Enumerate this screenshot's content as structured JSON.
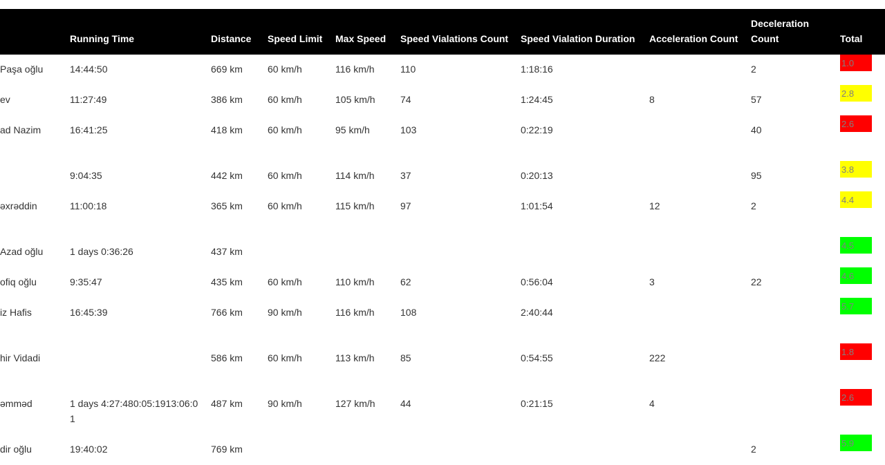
{
  "colors": {
    "red": "#ff0000",
    "yellow": "#ffff00",
    "green": "#00ff00"
  },
  "headers": {
    "name": "",
    "running_time": "Running Time",
    "distance": "Distance",
    "speed_limit": "Speed Limit",
    "max_speed": "Max Speed",
    "violations_count": "Speed Vialations Count",
    "violation_duration": "Speed Vialation Duration",
    "acceleration_count": "Acceleration Count",
    "deceleration_count": "Deceleration Count",
    "total": "Total"
  },
  "rows": [
    {
      "name": "Paşa oğlu",
      "running_time": "14:44:50",
      "distance": "669 km",
      "speed_limit": "60 km/h",
      "max_speed": "116 km/h",
      "violations_count": "110",
      "violation_duration": "1:18:16",
      "acceleration_count": "",
      "deceleration_count": "2",
      "total": "1.0",
      "total_color": "red"
    },
    {
      "name": "ev",
      "running_time": "11:27:49",
      "distance": "386 km",
      "speed_limit": "60 km/h",
      "max_speed": "105 km/h",
      "violations_count": "74",
      "violation_duration": "1:24:45",
      "acceleration_count": "8",
      "deceleration_count": "57",
      "total": "2.8",
      "total_color": "yellow"
    },
    {
      "name": "ad Nazim",
      "running_time": "16:41:25",
      "distance": "418 km",
      "speed_limit": "60 km/h",
      "max_speed": "95 km/h",
      "violations_count": "103",
      "violation_duration": "0:22:19",
      "acceleration_count": "",
      "deceleration_count": "40",
      "total": "2.6",
      "total_color": "red"
    },
    {
      "name": "",
      "running_time": "9:04:35",
      "distance": "442 km",
      "speed_limit": "60 km/h",
      "max_speed": "114 km/h",
      "violations_count": "37",
      "violation_duration": "0:20:13",
      "acceleration_count": "",
      "deceleration_count": "95",
      "total": "3.8",
      "total_color": "yellow"
    },
    {
      "name": "əxrəddin",
      "running_time": "11:00:18",
      "distance": "365 km",
      "speed_limit": "60 km/h",
      "max_speed": "115 km/h",
      "violations_count": "97",
      "violation_duration": "1:01:54",
      "acceleration_count": "12",
      "deceleration_count": "2",
      "total": "4.4",
      "total_color": "yellow"
    },
    {
      "name": "Azad oğlu",
      "running_time": "1 days 0:36:26",
      "distance": "437 km",
      "speed_limit": "",
      "max_speed": "",
      "violations_count": "",
      "violation_duration": "",
      "acceleration_count": "",
      "deceleration_count": "",
      "total": "4.5",
      "total_color": "green"
    },
    {
      "name": "ofiq oğlu",
      "running_time": "9:35:47",
      "distance": "435 km",
      "speed_limit": "60 km/h",
      "max_speed": "110 km/h",
      "violations_count": "62",
      "violation_duration": "0:56:04",
      "acceleration_count": "3",
      "deceleration_count": "22",
      "total": "4.6",
      "total_color": "green"
    },
    {
      "name": "iz Hafis",
      "running_time": "16:45:39",
      "distance": "766 km",
      "speed_limit": "90 km/h",
      "max_speed": "116 km/h",
      "violations_count": "108",
      "violation_duration": "2:40:44",
      "acceleration_count": "",
      "deceleration_count": "",
      "total": "5.7",
      "total_color": "green"
    },
    {
      "name": "hir Vidadi",
      "running_time": "",
      "distance": "586 km",
      "speed_limit": "60 km/h",
      "max_speed": "113 km/h",
      "violations_count": "85",
      "violation_duration": "0:54:55",
      "acceleration_count": "222",
      "deceleration_count": "",
      "total": "1.8",
      "total_color": "red"
    },
    {
      "name": "əmməd",
      "running_time": "1 days 4:27:480:05:1913:06:01",
      "distance": "487 km",
      "speed_limit": "90 km/h",
      "max_speed": "127 km/h",
      "violations_count": "44",
      "violation_duration": "0:21:15",
      "acceleration_count": "4",
      "deceleration_count": "",
      "total": "2.6",
      "total_color": "red"
    },
    {
      "name": "dir oğlu",
      "running_time": "19:40:02",
      "distance": "769 km",
      "speed_limit": "",
      "max_speed": "",
      "violations_count": "",
      "violation_duration": "",
      "acceleration_count": "",
      "deceleration_count": "2",
      "total": "5.9",
      "total_color": "green"
    }
  ]
}
